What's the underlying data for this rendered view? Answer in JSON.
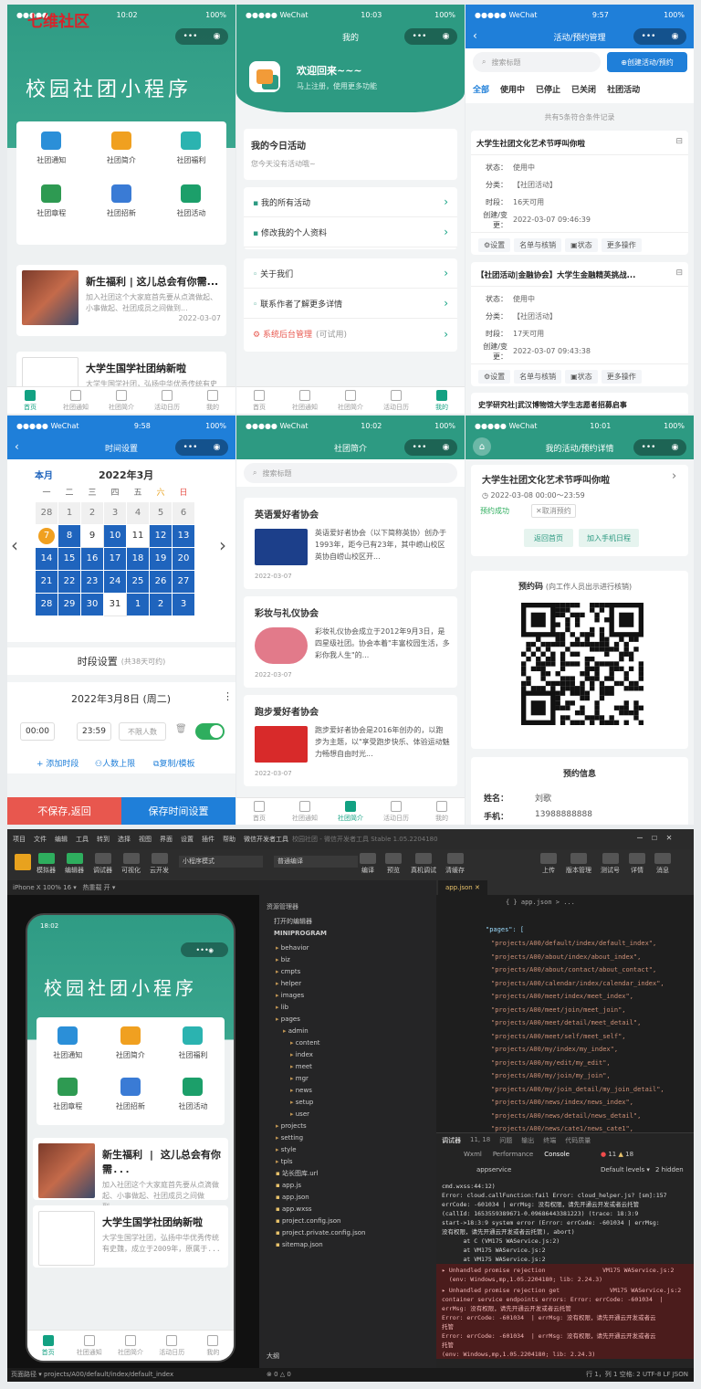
{
  "watermark": "七维社区",
  "p1": {
    "time": "10:02",
    "battery": "100%",
    "banner": "校园社团小程序",
    "grid": [
      {
        "label": "社团通知",
        "color": "#2b8fd8"
      },
      {
        "label": "社团简介",
        "color": "#f0a020"
      },
      {
        "label": "社团福利",
        "color": "#2bb3b0"
      },
      {
        "label": "社团章程",
        "color": "#2e9a52"
      },
      {
        "label": "社团招新",
        "color": "#3a7bd5"
      },
      {
        "label": "社团活动",
        "color": "#1c9f6a"
      }
    ],
    "news": [
      {
        "title": "新生福利 | 这儿总会有你需...",
        "desc": "加入社团这个大家庭首先要从点滴做起、小事做起、社团成员之间做到...",
        "date": "2022-03-07"
      },
      {
        "title": "大学生国学社团纳新啦",
        "desc": "大学生国学社团，弘扬中华优秀传统有史魏，成立于2009年，原属于...",
        "date": ""
      }
    ],
    "tabs": [
      "首页",
      "社团通知",
      "社团简介",
      "活动日历",
      "我的"
    ]
  },
  "p2": {
    "time": "10:03",
    "wechat": "●●●●● WeChat",
    "title": "我的",
    "welcome": "欢迎回来~~~",
    "sub": "马上注册，使用更多功能",
    "today_title": "我的今日活动",
    "today_empty": "您今天没有活动哦~",
    "menu1": [
      "我的所有活动",
      "修改我的个人资料"
    ],
    "menu2": [
      "关于我们",
      "联系作者了解更多详情"
    ],
    "admin": "系统后台管理",
    "admin_note": "(可试用)",
    "tabs": [
      "首页",
      "社团通知",
      "社团简介",
      "活动日历",
      "我的"
    ]
  },
  "p3": {
    "time": "9:57",
    "title": "活动/预约管理",
    "search": "搜索标题",
    "create": "⊕创建活动/预约",
    "filters": [
      "全部",
      "使用中",
      "已停止",
      "已关闭",
      "社团活动"
    ],
    "count": "共有5条符合条件记录",
    "items": [
      {
        "title": "大学生社团文化艺术节呼叫你啦",
        "status": "使用中",
        "cat": "【社团活动】",
        "dur": "16天可用",
        "created": "2022-03-07 09:46:39"
      },
      {
        "title": "【社团活动|金融协会】大学生金融精英挑战...",
        "status": "使用中",
        "cat": "【社团活动】",
        "dur": "17天可用",
        "created": "2022-03-07 09:43:38"
      }
    ],
    "k_status": "状态：",
    "k_cat": "分类：",
    "k_dur": "时段：",
    "k_created": "创建/变更：",
    "actions": [
      "⚙设置",
      "名单与核销",
      "▣状态",
      "更多操作"
    ],
    "third": "史学研究社|武汉博物馆大学生志愿者招募启事"
  },
  "p4": {
    "time": "9:58",
    "title": "时间设置",
    "month_tag": "本月",
    "month": "2022年3月",
    "week": [
      "一",
      "二",
      "三",
      "四",
      "五",
      "六",
      "日"
    ],
    "days": [
      [
        "28",
        "1",
        "2",
        "3",
        "4",
        "5",
        "6"
      ],
      [
        "7",
        "8",
        "9",
        "10",
        "11",
        "12",
        "13"
      ],
      [
        "14",
        "15",
        "16",
        "17",
        "18",
        "19",
        "20"
      ],
      [
        "21",
        "22",
        "23",
        "24",
        "25",
        "26",
        "27"
      ],
      [
        "28",
        "29",
        "30",
        "31",
        "1",
        "2",
        "3"
      ]
    ],
    "slot_title": "时段设置",
    "slot_note": "(共38天可约)",
    "date": "2022年3月8日 (周二)",
    "start": "00:00",
    "end": "23:59",
    "limit": "不限人数",
    "add": "+ 添加时段",
    "people": "人数上限",
    "copy": "复制/模板",
    "cancel": "不保存,返回",
    "save": "保存时间设置"
  },
  "p5": {
    "time": "10:02",
    "title": "社团简介",
    "search": "搜索标题",
    "clubs": [
      {
        "name": "英语爱好者协会",
        "desc": "英语爱好者协会（以下简称英协）创办于1993年，距今已有23年，其中崂山校区英协自崂山校区开...",
        "date": "2022-03-07"
      },
      {
        "name": "彩妆与礼仪协会",
        "desc": "彩妆礼仪协会成立于2012年9月3日，是四星级社团。协会本着\"丰富校园生活，多彩你我人生\"的...",
        "date": "2022-03-07"
      },
      {
        "name": "跑步爱好者协会",
        "desc": "跑步爱好者协会是2016年创办的，以跑步为主题，以\"享受跑步快乐、体验运动魅力畅想自由时光...",
        "date": "2022-03-07"
      }
    ],
    "tabs": [
      "首页",
      "社团通知",
      "社团简介",
      "活动日历",
      "我的"
    ]
  },
  "p6": {
    "time": "10:01",
    "title": "我的活动/预约详情",
    "event": "大学生社团文化艺术节呼叫你啦",
    "range": "2022-03-08 00:00～23:59",
    "ok": "预约成功",
    "cancel": "✕取消预约",
    "home": "返回首页",
    "cal": "加入手机日程",
    "code_title": "预约码",
    "code_note": "(向工作人员出示进行核销)",
    "info_title": "预约信息",
    "name_k": "姓名：",
    "name_v": "刘歌",
    "phone_k": "手机：",
    "phone_v": "13988888888"
  },
  "ide": {
    "menu": [
      "项目",
      "文件",
      "编辑",
      "工具",
      "转到",
      "选择",
      "视图",
      "界面",
      "设置",
      "插件",
      "帮助",
      "微信开发者工具"
    ],
    "app": "校园社团 - 微信开发者工具 Stable 1.05.2204180",
    "tools": [
      "模拟器",
      "编辑器",
      "调试器",
      "可视化",
      "云开发"
    ],
    "mode": "小程序模式",
    "compile": "普通编译",
    "rtools": [
      "编译",
      "预览",
      "真机调试",
      "清缓存"
    ],
    "far": [
      "上传",
      "版本管理",
      "测试号",
      "详情",
      "消息"
    ],
    "device": "iPhone X 100% 16 ▾",
    "hot": "热重载 开 ▾",
    "explorer": "资源管理器",
    "open_editors": "打开的编辑器",
    "project": "MINIPROGRAM",
    "tree": [
      {
        "n": "behavior",
        "d": 1
      },
      {
        "n": "biz",
        "d": 1
      },
      {
        "n": "cmpts",
        "d": 1
      },
      {
        "n": "helper",
        "d": 1
      },
      {
        "n": "images",
        "d": 1
      },
      {
        "n": "lib",
        "d": 1
      },
      {
        "n": "pages",
        "d": 1
      },
      {
        "n": "admin",
        "d": 2
      },
      {
        "n": "content",
        "d": 3
      },
      {
        "n": "index",
        "d": 3
      },
      {
        "n": "meet",
        "d": 3
      },
      {
        "n": "mgr",
        "d": 3
      },
      {
        "n": "news",
        "d": 3
      },
      {
        "n": "setup",
        "d": 3
      },
      {
        "n": "user",
        "d": 3
      },
      {
        "n": "projects",
        "d": 1
      },
      {
        "n": "setting",
        "d": 1
      },
      {
        "n": "style",
        "d": 1
      },
      {
        "n": "tpls",
        "d": 1
      },
      {
        "n": "站长图库.url",
        "d": 1
      },
      {
        "n": "app.js",
        "d": 1
      },
      {
        "n": "app.json",
        "d": 1
      },
      {
        "n": "app.wxss",
        "d": 1
      },
      {
        "n": "project.config.json",
        "d": 1
      },
      {
        "n": "project.private.config.json",
        "d": 1
      },
      {
        "n": "sitemap.json",
        "d": 1
      }
    ],
    "outline": "大纲",
    "tab": "app.json",
    "crumb": "{ } app.json > ...",
    "pages_key": "\"pages\": [",
    "code": [
      "\"projects/A00/default/index/default_index\",",
      "\"projects/A00/about/index/about_index\",",
      "\"projects/A00/about/contact/about_contact\",",
      "\"projects/A00/calendar/index/calendar_index\",",
      "\"projects/A00/meet/index/meet_index\",",
      "\"projects/A00/meet/join/meet_join\",",
      "\"projects/A00/meet/detail/meet_detail\",",
      "\"projects/A00/meet/self/meet_self\",",
      "\"projects/A00/my/index/my_index\",",
      "\"projects/A00/my/edit/my_edit\",",
      "\"projects/A00/my/join/my_join\",",
      "\"projects/A00/my/join_detail/my_join_detail\",",
      "\"projects/A00/news/index/news_index\",",
      "\"projects/A00/news/detail/news_detail\",",
      "\"projects/A00/news/cate1/news_cate1\","
    ],
    "dbg_tabs": [
      "调试器",
      "11, 18",
      "问题",
      "输出",
      "终端",
      "代码质量"
    ],
    "con_tabs": [
      "Wxml",
      "Performance",
      "Console"
    ],
    "errs": "11",
    "warns": "18",
    "ctx": "appservice",
    "levels": "Default levels ▾",
    "hidden": "2 hidden",
    "console": [
      "cmd.wxss:44:12)",
      "Error: cloud.callFunction:fail Error: cloud_helper.js? [sm]:157",
      "errCode: -601034 | errMsg: 没有权限，请先开通云开发或者云托管",
      "(callId: 1653559389671-0.09686443381223) (trace: 18:3:9",
      "start->18:3:9 system error (Error: errCode: -601034 | errMsg:",
      "没有权限，请先开通云开发或者云托管), abort)",
      "      at C (VM175 WAService.js:2)",
      "      at VM175 WAService.js:2",
      "      at VM175 WAService.js:2",
      "      at n (VM175 WAService.js:2)"
    ],
    "err1": [
      "▸ Unhandled promise rejection                VM175 WAService.js:2",
      "  (env: Windows,mp,1.05.2204180; lib: 2.24.3)"
    ],
    "err2": [
      "▸ Unhandled promise rejection get              VM175 WAService.js:2",
      "container service endpoints errors: Error: errCode: -601034  |",
      "errMsg: 没有权限，请先开通云开发或者云托管",
      "Error: errCode: -601034  | errMsg: 没有权限，请先开通云开发或者云",
      "托管",
      "Error: errCode: -601034  | errMsg: 没有权限，请先开通云开发或者云",
      "托管",
      "(env: Windows,mp,1.05.2204180; lib: 2.24.3)"
    ],
    "status_left": "页面路径 ▾  projects/A00/default/index/default_index",
    "status_mid": "⊗ 0 △ 0",
    "status_right": "行 1，列 1  空格: 2  UTF-8  LF  JSON",
    "sim_time": "18:02"
  }
}
